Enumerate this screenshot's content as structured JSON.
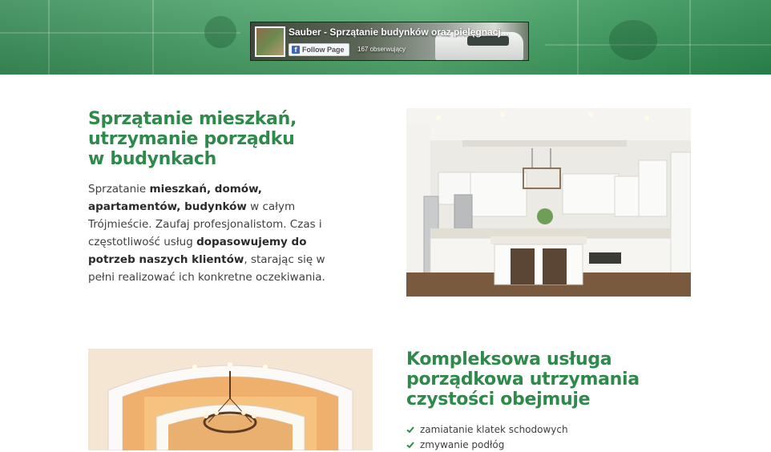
{
  "colors": {
    "accent_green": "#2e8a4a",
    "body_text": "#3f3f3f",
    "facebook_blue": "#4267b2"
  },
  "facebook_widget": {
    "page_name": "Sauber - Sprzątanie budynków oraz pielęgnacj...",
    "follow_label": "Follow Page",
    "followers": "167 obserwujący"
  },
  "section_apartments": {
    "title_lines": [
      "Sprzątanie mieszkań,",
      "utrzymanie porządku",
      "w budynkach"
    ],
    "paragraph": [
      {
        "text": "Sprzatanie ",
        "bold": false
      },
      {
        "text": "mieszkań, domów, apartamentów, budynków",
        "bold": true
      },
      {
        "text": " w całym Trójmieście. Zaufaj profesjonalistom. Czas i częstotliwość usług ",
        "bold": false
      },
      {
        "text": "dopasowujemy do potrzeb naszych klientów",
        "bold": true
      },
      {
        "text": ", starając się w pełni realizować ich konkretne oczekiwania.",
        "bold": false
      }
    ]
  },
  "section_services": {
    "title_lines": [
      "Kompleksowa usługa",
      "porządkowa utrzymania",
      "czystości obejmuje"
    ],
    "items": [
      "zamiatanie klatek schodowych",
      "zmywanie podłóg"
    ]
  }
}
